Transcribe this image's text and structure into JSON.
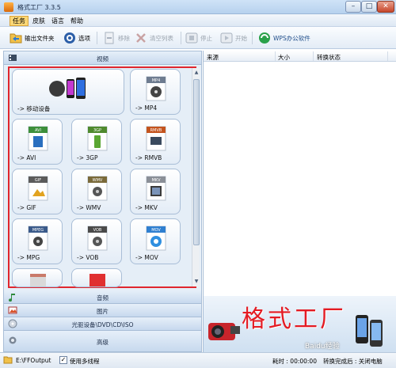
{
  "window": {
    "title": "格式工厂 3.3.5"
  },
  "menu": [
    "任务",
    "皮肤",
    "语言",
    "帮助"
  ],
  "toolbar": {
    "output_folder": "输出文件夹",
    "options": "选项",
    "remove": "移除",
    "clear_list": "清空列表",
    "stop": "停止",
    "start": "开始",
    "wps": "WPS办公软件"
  },
  "categories": {
    "video": "视频",
    "audio": "音频",
    "image": "图片",
    "disc": "光驱设备\\DVD\\CD\\ISO",
    "advanced": "高级"
  },
  "formats": [
    {
      "label": "-> 移动设备",
      "badge": ""
    },
    {
      "label": "-> MP4",
      "badge": "MP4"
    },
    {
      "label": "-> AVI",
      "badge": "AVI"
    },
    {
      "label": "-> 3GP",
      "badge": "3GP"
    },
    {
      "label": "-> RMVB",
      "badge": "RMVB"
    },
    {
      "label": "-> GIF",
      "badge": "GIF"
    },
    {
      "label": "-> WMV",
      "badge": "WMV"
    },
    {
      "label": "-> MKV",
      "badge": "MKV"
    },
    {
      "label": "-> MPG",
      "badge": "MPEG"
    },
    {
      "label": "-> VOB",
      "badge": "VOB"
    },
    {
      "label": "-> MOV",
      "badge": "MOV"
    }
  ],
  "task_list": {
    "columns": {
      "source": "来源",
      "size": "大小",
      "status": "转换状态"
    }
  },
  "banner": {
    "title": "格式工厂",
    "watermark": "Baidu经验"
  },
  "status": {
    "output_path": "E:\\FFOutput",
    "multithread": "使用多线程",
    "multithread_checked": true,
    "elapsed": "耗时 : 00:00:00",
    "after_convert": "转换完成后 : 关闭电脑"
  },
  "colors": {
    "highlight_outline": "#e0262e",
    "banner_title": "#e41b23"
  }
}
